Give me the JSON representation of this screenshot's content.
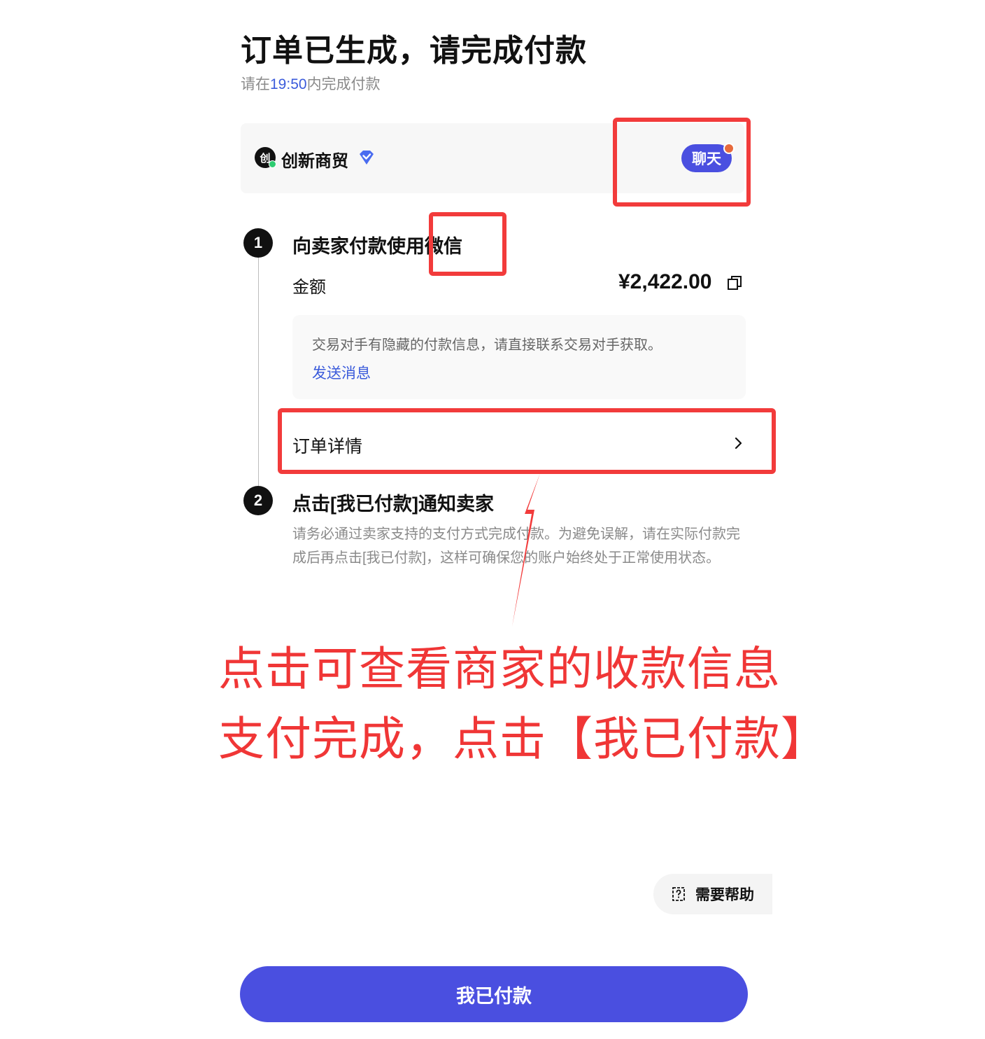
{
  "header": {
    "title": "订单已生成，请完成付款",
    "countdown_prefix": "请在",
    "countdown_time": "19:50",
    "countdown_suffix": "内完成付款"
  },
  "merchant": {
    "logo_text": "创",
    "name": "创新商贸",
    "chat_label": "聊天"
  },
  "step1": {
    "number": "1",
    "title_prefix": "向卖家付款使用",
    "method": "微信",
    "amount_label": "金额",
    "amount_value": "¥2,422.00",
    "notice": "交易对手有隐藏的付款信息，请直接联系交易对手获取。",
    "send_message_label": "发送消息",
    "order_detail_label": "订单详情"
  },
  "step2": {
    "number": "2",
    "title": "点击[我已付款]通知卖家",
    "description": "请务必通过卖家支持的支付方式完成付款。为避免误解，请在实际付款完成后再点击[我已付款]，这样可确保您的账户始终处于正常使用状态。"
  },
  "annotation": {
    "line1": "点击可查看商家的收款信息",
    "line2": "支付完成，点击【我已付款】"
  },
  "help": {
    "label": "需要帮助",
    "icon": "question-icon"
  },
  "footer": {
    "paid_button_label": "我已付款"
  },
  "colors": {
    "accent": "#4a4fe0",
    "link": "#3b5bdb",
    "annotation_red": "#f23b3b",
    "online": "#2ecc71",
    "notify_dot": "#e76a3c"
  }
}
